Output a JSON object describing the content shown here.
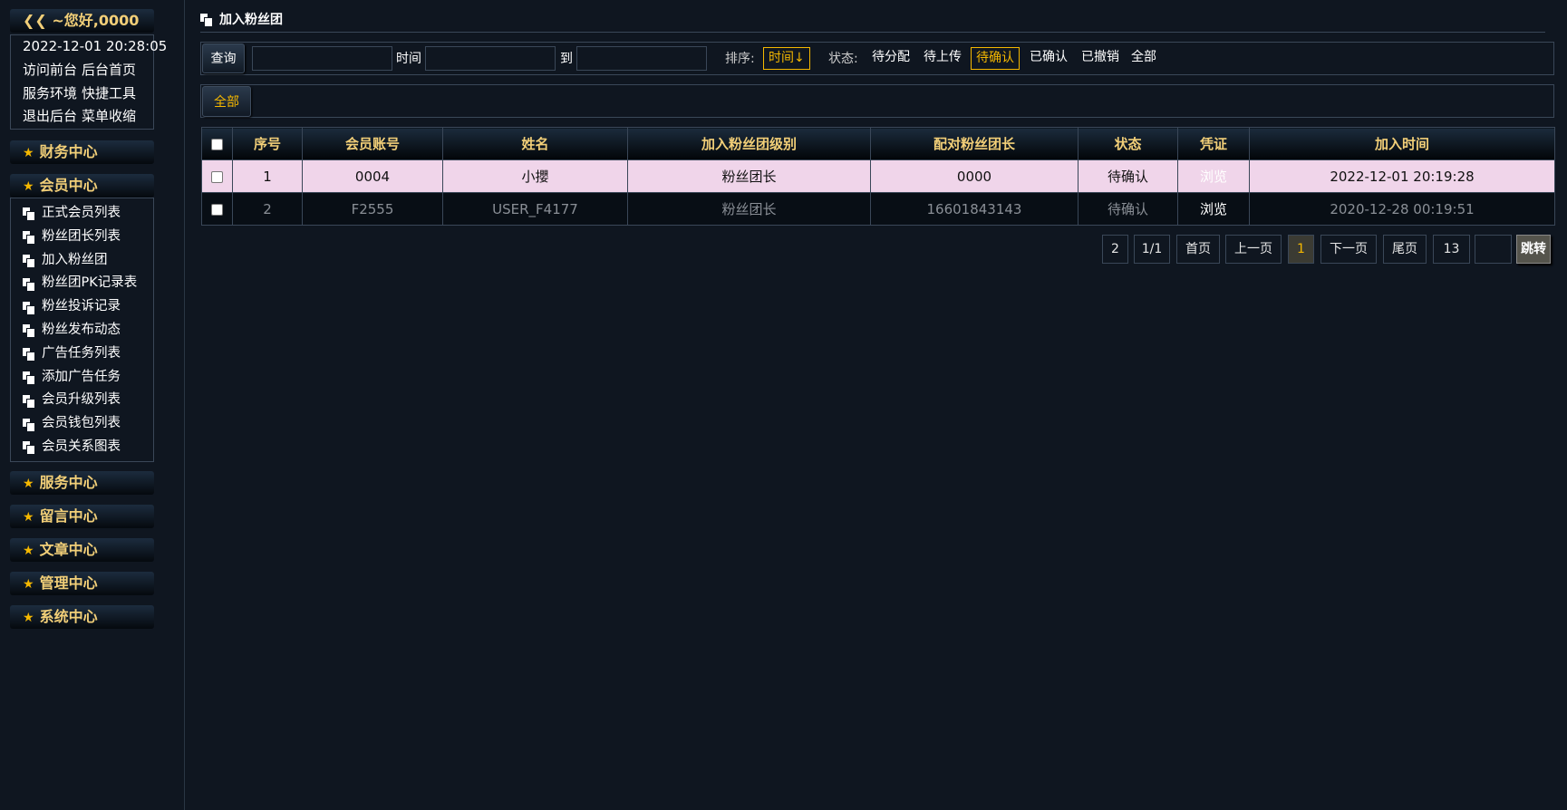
{
  "sidebar": {
    "greeting": "~您好,0000",
    "datetime": "2022-12-01 20:28:05",
    "links": [
      [
        "访问前台",
        "后台首页"
      ],
      [
        "服务环境",
        "快捷工具"
      ],
      [
        "退出后台",
        "菜单收缩"
      ]
    ],
    "sections": [
      "财务中心",
      "会员中心",
      "服务中心",
      "留言中心",
      "文章中心",
      "管理中心",
      "系统中心"
    ],
    "member_items": [
      "正式会员列表",
      "粉丝团长列表",
      "加入粉丝团",
      "粉丝团PK记录表",
      "粉丝投诉记录",
      "粉丝发布动态",
      "广告任务列表",
      "添加广告任务",
      "会员升级列表",
      "会员钱包列表",
      "会员关系图表"
    ]
  },
  "page": {
    "title": "加入粉丝团"
  },
  "filter": {
    "query_label": "查询",
    "time_label": "时间",
    "to_label": "到",
    "sort_label": "排序:",
    "sort_value": "时间↓",
    "status_label": "状态:",
    "statuses": [
      "待分配",
      "待上传",
      "待确认",
      "已确认",
      "已撤销",
      "全部"
    ],
    "active_status": "待确认"
  },
  "tabs": {
    "all": "全部"
  },
  "table": {
    "headers": [
      "序号",
      "会员账号",
      "姓名",
      "加入粉丝团级别",
      "配对粉丝团长",
      "状态",
      "凭证",
      "加入时间"
    ],
    "rows": [
      [
        "1",
        "0004",
        "小攖",
        "粉丝团长",
        "0000",
        "待确认",
        "浏览",
        "2022-12-01 20:19:28"
      ],
      [
        "2",
        "F2555",
        "USER_F4177",
        "粉丝团长",
        "16601843143",
        "待确认",
        "浏览",
        "2020-12-28 00:19:51"
      ]
    ]
  },
  "pagination": {
    "total": "2",
    "pages": "1/1",
    "first": "首页",
    "prev": "上一页",
    "current": "1",
    "next": "下一页",
    "last": "尾页",
    "per_page": "13",
    "jump": "跳转"
  }
}
